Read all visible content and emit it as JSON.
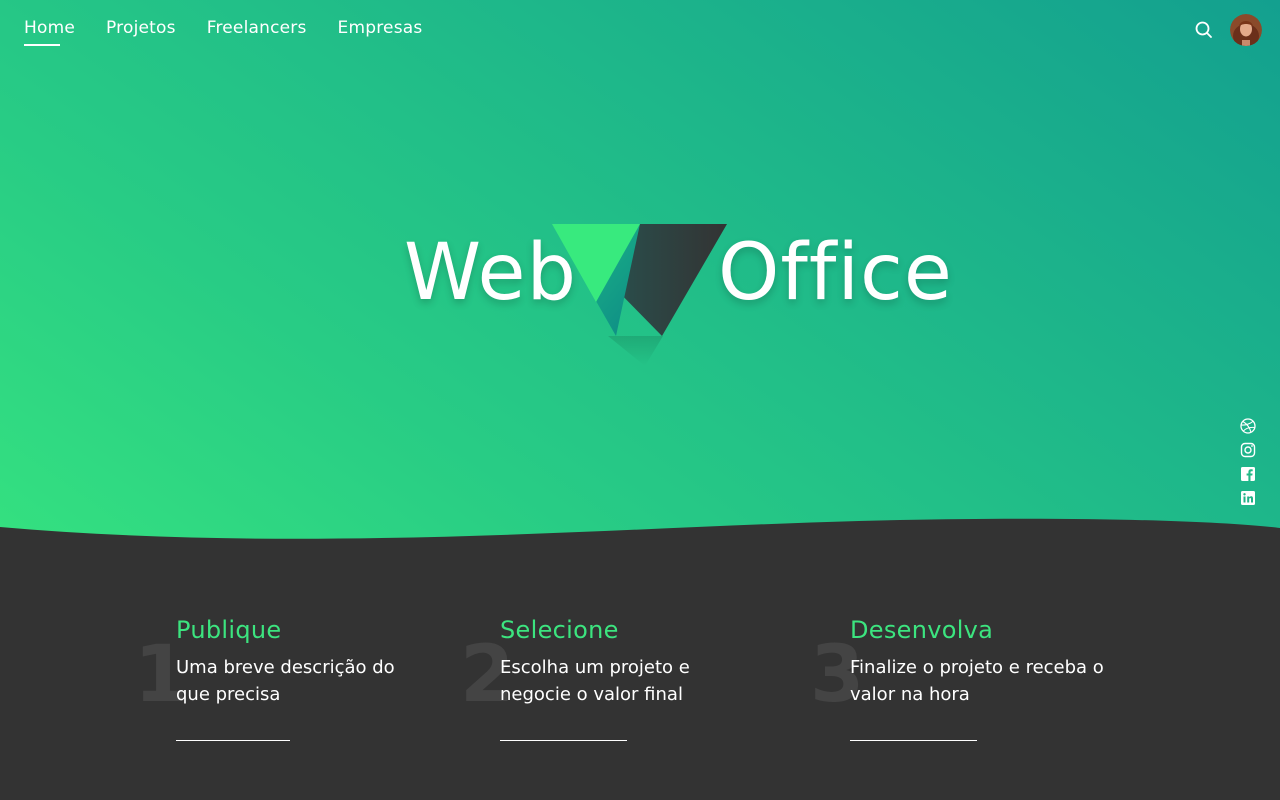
{
  "nav": {
    "items": [
      {
        "label": "Home",
        "active": true
      },
      {
        "label": "Projetos",
        "active": false
      },
      {
        "label": "Freelancers",
        "active": false
      },
      {
        "label": "Empresas",
        "active": false
      }
    ]
  },
  "header": {
    "search_icon": "search-icon",
    "avatar": "user-avatar"
  },
  "logo": {
    "word_left": "Web",
    "word_right": "Office"
  },
  "social": {
    "icons": [
      "dribbble-icon",
      "instagram-icon",
      "facebook-icon",
      "linkedin-icon"
    ]
  },
  "steps": [
    {
      "number": "1",
      "title": "Publique",
      "description": "Uma breve descrição do que precisa"
    },
    {
      "number": "2",
      "title": "Selecione",
      "description": "Escolha um projeto e negocie o valor final"
    },
    {
      "number": "3",
      "title": "Desenvolva",
      "description": "Finalize o projeto e receba o valor na hora"
    }
  ],
  "colors": {
    "gradient_start": "#3ced7d",
    "gradient_end": "#13a08f",
    "dark_bg": "#333333",
    "accent": "#3ce47f",
    "step_number": "#444444"
  }
}
